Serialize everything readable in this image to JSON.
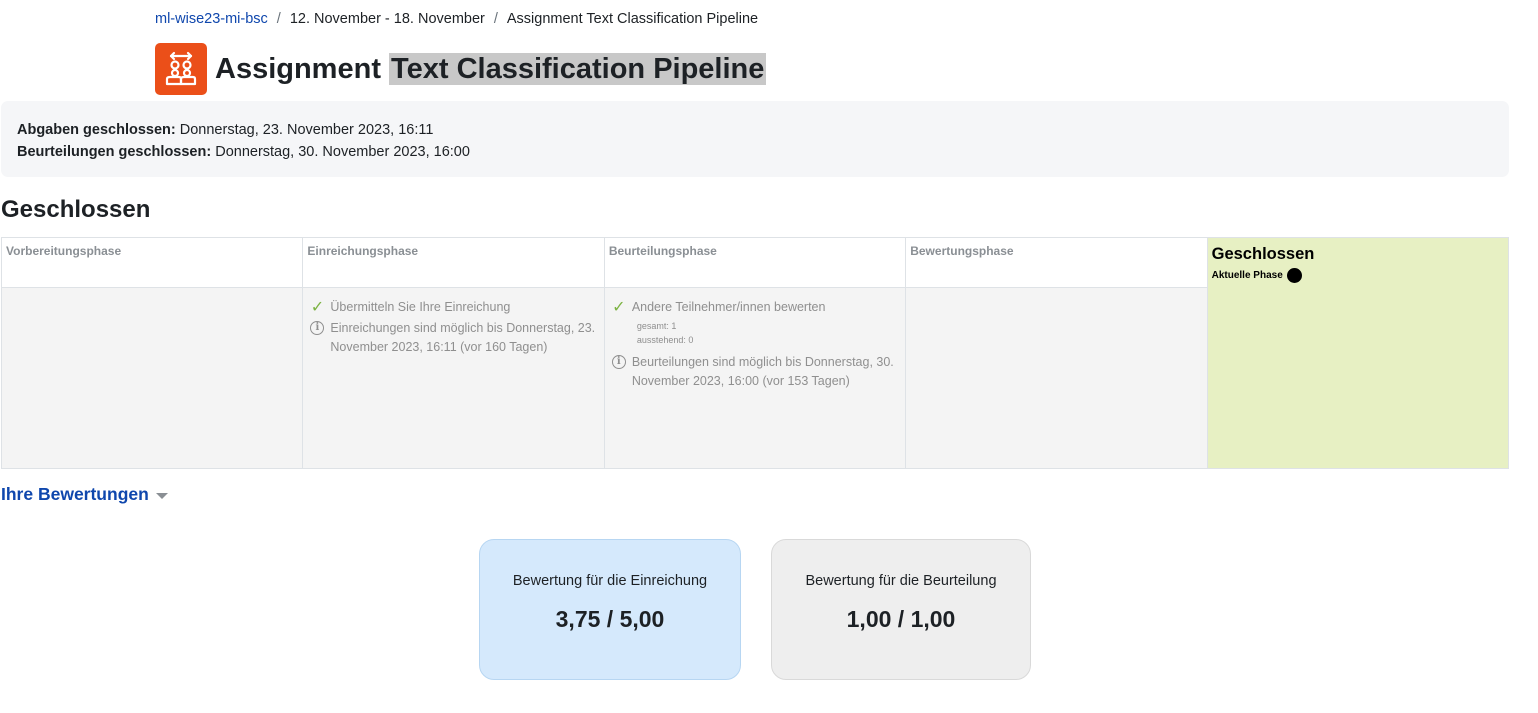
{
  "breadcrumb": {
    "course": "ml-wise23-mi-bsc",
    "week": "12. November - 18. November",
    "current": "Assignment Text Classification Pipeline"
  },
  "header": {
    "title_prefix": "Assignment",
    "title_highlight": "Text Classification Pipeline",
    "icon_color": "#eb4f19"
  },
  "dates": {
    "submissions_label": "Abgaben geschlossen:",
    "submissions_value": "Donnerstag, 23. November 2023, 16:11",
    "assessments_label": "Beurteilungen geschlossen:",
    "assessments_value": "Donnerstag, 30. November 2023, 16:00"
  },
  "section_title": "Geschlossen",
  "phases": {
    "setup": {
      "name": "Vorbereitungsphase"
    },
    "submission": {
      "name": "Einreichungsphase",
      "task": "Übermitteln Sie Ihre Einreichung",
      "info": "Einreichungen sind möglich bis Donnerstag, 23. November 2023, 16:11 (vor 160 Tagen)"
    },
    "assessment": {
      "name": "Beurteilungsphase",
      "task": "Andere Teilnehmer/innen bewerten",
      "total": "gesamt: 1",
      "pending": "ausstehend: 0",
      "info": "Beurteilungen sind möglich bis Donnerstag, 30. November 2023, 16:00 (vor 153 Tagen)"
    },
    "evaluation": {
      "name": "Bewertungsphase"
    },
    "closed": {
      "name": "Geschlossen",
      "current_label": "Aktuelle Phase",
      "color": "#e7f0c3"
    }
  },
  "grades": {
    "toggle_label": "Ihre Bewertungen",
    "submission": {
      "label": "Bewertung für die Einreichung",
      "value": "3,75 / 5,00",
      "color": "#d5e9fc"
    },
    "assessment": {
      "label": "Bewertung für die Beurteilung",
      "value": "1,00 / 1,00",
      "color": "#eeeeee"
    }
  }
}
